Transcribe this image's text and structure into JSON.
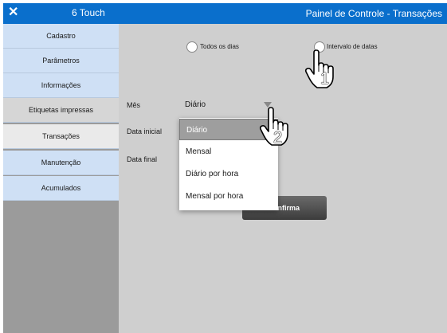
{
  "titlebar": {
    "close_glyph": "✕",
    "app_name": "6 Touch",
    "title": "Painel de Controle - Transações",
    "color": "#0a6fcc"
  },
  "sidebar": {
    "items": [
      {
        "label": "Cadastro"
      },
      {
        "label": "Parâmetros"
      },
      {
        "label": "Informações"
      },
      {
        "label": "Etiquetas impressas"
      },
      {
        "label": "Transações"
      },
      {
        "label": "Manutenção"
      },
      {
        "label": "Acumulados"
      }
    ],
    "active": "Transações"
  },
  "filter": {
    "radio_all_days": "Todos os dias",
    "radio_date_range": "Intervalo de datas",
    "month_label": "Mês",
    "month_value": "Diário",
    "start_date_label": "Data inicial",
    "end_date_label": "Data final"
  },
  "dropdown": {
    "options": [
      "Diário",
      "Mensal",
      "Diário por hora",
      "Mensal por hora"
    ],
    "selected": "Diário"
  },
  "confirm_button": {
    "label": "nfirma"
  },
  "annotations": {
    "step1": "1",
    "step2": "2",
    "icon": "pointing-hand-icon"
  }
}
